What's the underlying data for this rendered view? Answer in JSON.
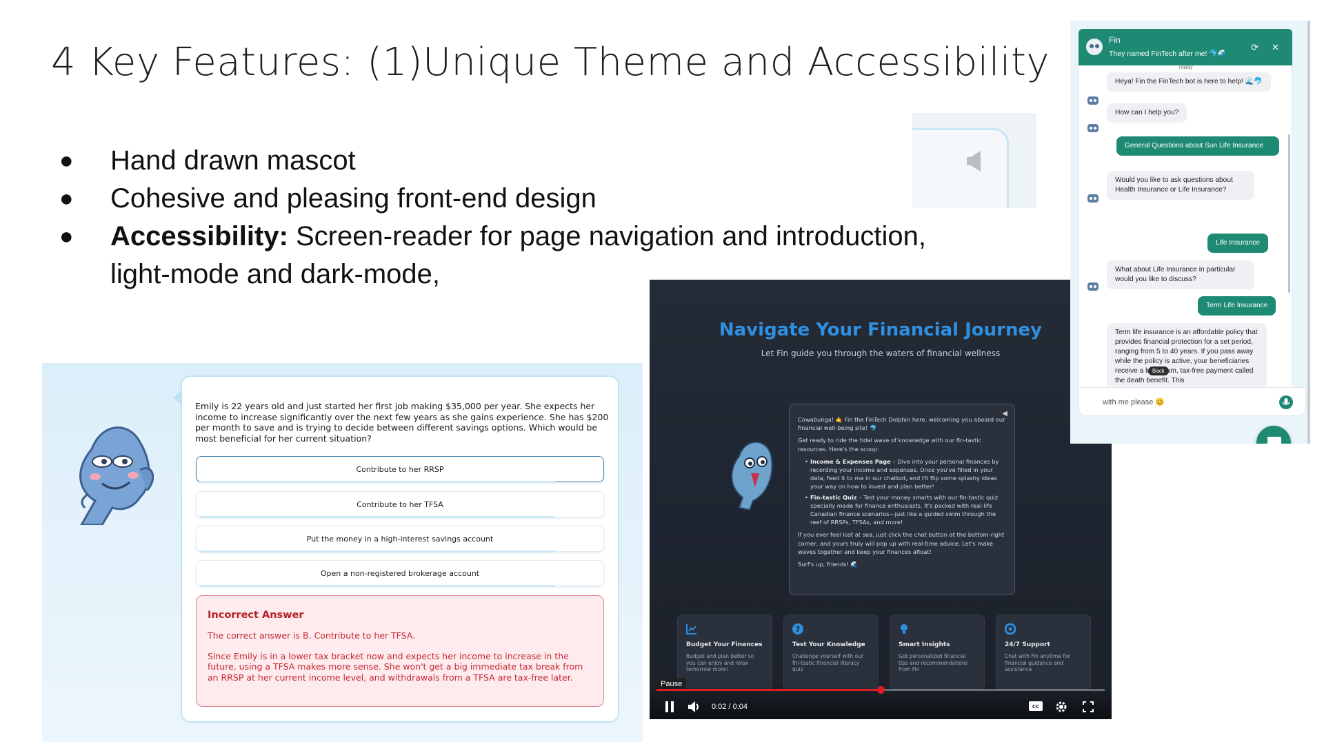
{
  "slide": {
    "title": "4 Key Features: (1)Unique Theme and Accessibility",
    "bullet_char": "●",
    "bullets": [
      {
        "text": "Hand drawn mascot"
      },
      {
        "text": "Cohesive and pleasing front-end design"
      },
      {
        "bold": "Accessibility:",
        "text": " Screen-reader for page navigation and introduction, light-mode and dark-mode,"
      }
    ]
  },
  "speaker_widget": {
    "icon": "speaker-muted-icon"
  },
  "quiz": {
    "question": "Emily is 22 years old and just started her first job making $35,000 per year. She expects her income to increase significantly over the next few years as she gains experience. She has $200 per month to save and is trying to decide between different savings options. Which would be most beneficial for her current situation?",
    "options": [
      "Contribute to her RRSP",
      "Contribute to her TFSA",
      "Put the money in a high-interest savings account",
      "Open a non-registered brokerage account"
    ],
    "selected_index": 0,
    "feedback": {
      "title": "Incorrect Answer",
      "answer": "The correct answer is B. Contribute to her TFSA.",
      "explanation": "Since Emily is in a lower tax bracket now and expects her income to increase in the future, using a TFSA makes more sense. She won't get a big immediate tax break from an RRSP at her current income level, and withdrawals from a TFSA are tax-free later."
    },
    "colors": {
      "error": "#c62832",
      "accent": "#bfe2f5"
    }
  },
  "video": {
    "title": "Navigate Your Financial Journey",
    "subtitle": "Let Fin guide you through the waters of financial wellness",
    "message": {
      "intro": "Cowabunga! 🤙 Fin the FinTech Dolphin here, welcoming you aboard our financial well-being site! 🐬",
      "lead": "Get ready to ride the tidal wave of knowledge with our fin-tastic resources. Here's the scoop:",
      "items": [
        {
          "bold": "Income & Expenses Page",
          "text": " – Dive into your personal finances by recording your income and expenses. Once you've filled in your data, feed it to me in our chatbot, and I'll flip some splashy ideas your way on how to invest and plan better!"
        },
        {
          "bold": "Fin-tastic Quiz",
          "text": " – Test your money smarts with our fin-tastic quiz specially made for finance enthusiasts. It's packed with real-life Canadian finance scenarios—just like a guided swim through the reef of RRSPs, TFSAs, and more!"
        }
      ],
      "outro": "If you ever feel lost at sea, just click the chat button at the bottom-right corner, and yours truly will pop up with real-time advice. Let's make waves together and keep your finances afloat!",
      "signoff": "Surf's up, friends! 🌊"
    },
    "features": [
      {
        "icon": "chart-icon",
        "title": "Budget Your Finances",
        "desc": "Budget and plan better so you can enjoy and relax tomorrow more!"
      },
      {
        "icon": "question-icon",
        "title": "Test Your Knowledge",
        "desc": "Challenge yourself with our fin-tastic financial literacy quiz"
      },
      {
        "icon": "lightbulb-icon",
        "title": "Smart Insights",
        "desc": "Get personalized financial tips and recommendations from Fin"
      },
      {
        "icon": "lifebuoy-icon",
        "title": "24/7 Support",
        "desc": "Chat with Fin anytime for financial guidance and assistance"
      }
    ],
    "controls": {
      "tooltip": "Pause",
      "time": "0:02 / 0:04",
      "progress": 0.5
    },
    "colors": {
      "title": "#2f8fe0",
      "progress": "#e31c23"
    }
  },
  "chat": {
    "name": "Fin",
    "tagline": "They named FinTech after me! 🐬🌊",
    "day_label": "Today",
    "messages": [
      {
        "from": "bot",
        "text": "Heya! Fin the FinTech bot is here to help! 🌊🐬"
      },
      {
        "from": "bot",
        "text": "How can I help you?"
      },
      {
        "from": "user",
        "text": "General Questions about Sun Life Insurance"
      },
      {
        "from": "bot",
        "text": "Would you like to ask questions about Health Insurance or Life Insurance?"
      },
      {
        "from": "user",
        "text": "Life Insurance"
      },
      {
        "from": "bot",
        "text": "What about Life Insurance in particular would you like to discuss?"
      },
      {
        "from": "user",
        "text": "Term Life Insurance"
      },
      {
        "from": "bot",
        "text": "Term life insurance is an affordable policy that provides financial protection for a set period, ranging from 5 to 40 years. If you pass away while the policy is active, your beneficiaries receive a lump-sum, tax-free payment called the death benefit. This"
      }
    ],
    "back_tooltip": "Back",
    "input_placeholder": "with me please 😊",
    "colors": {
      "brand": "#1f8a73"
    }
  }
}
